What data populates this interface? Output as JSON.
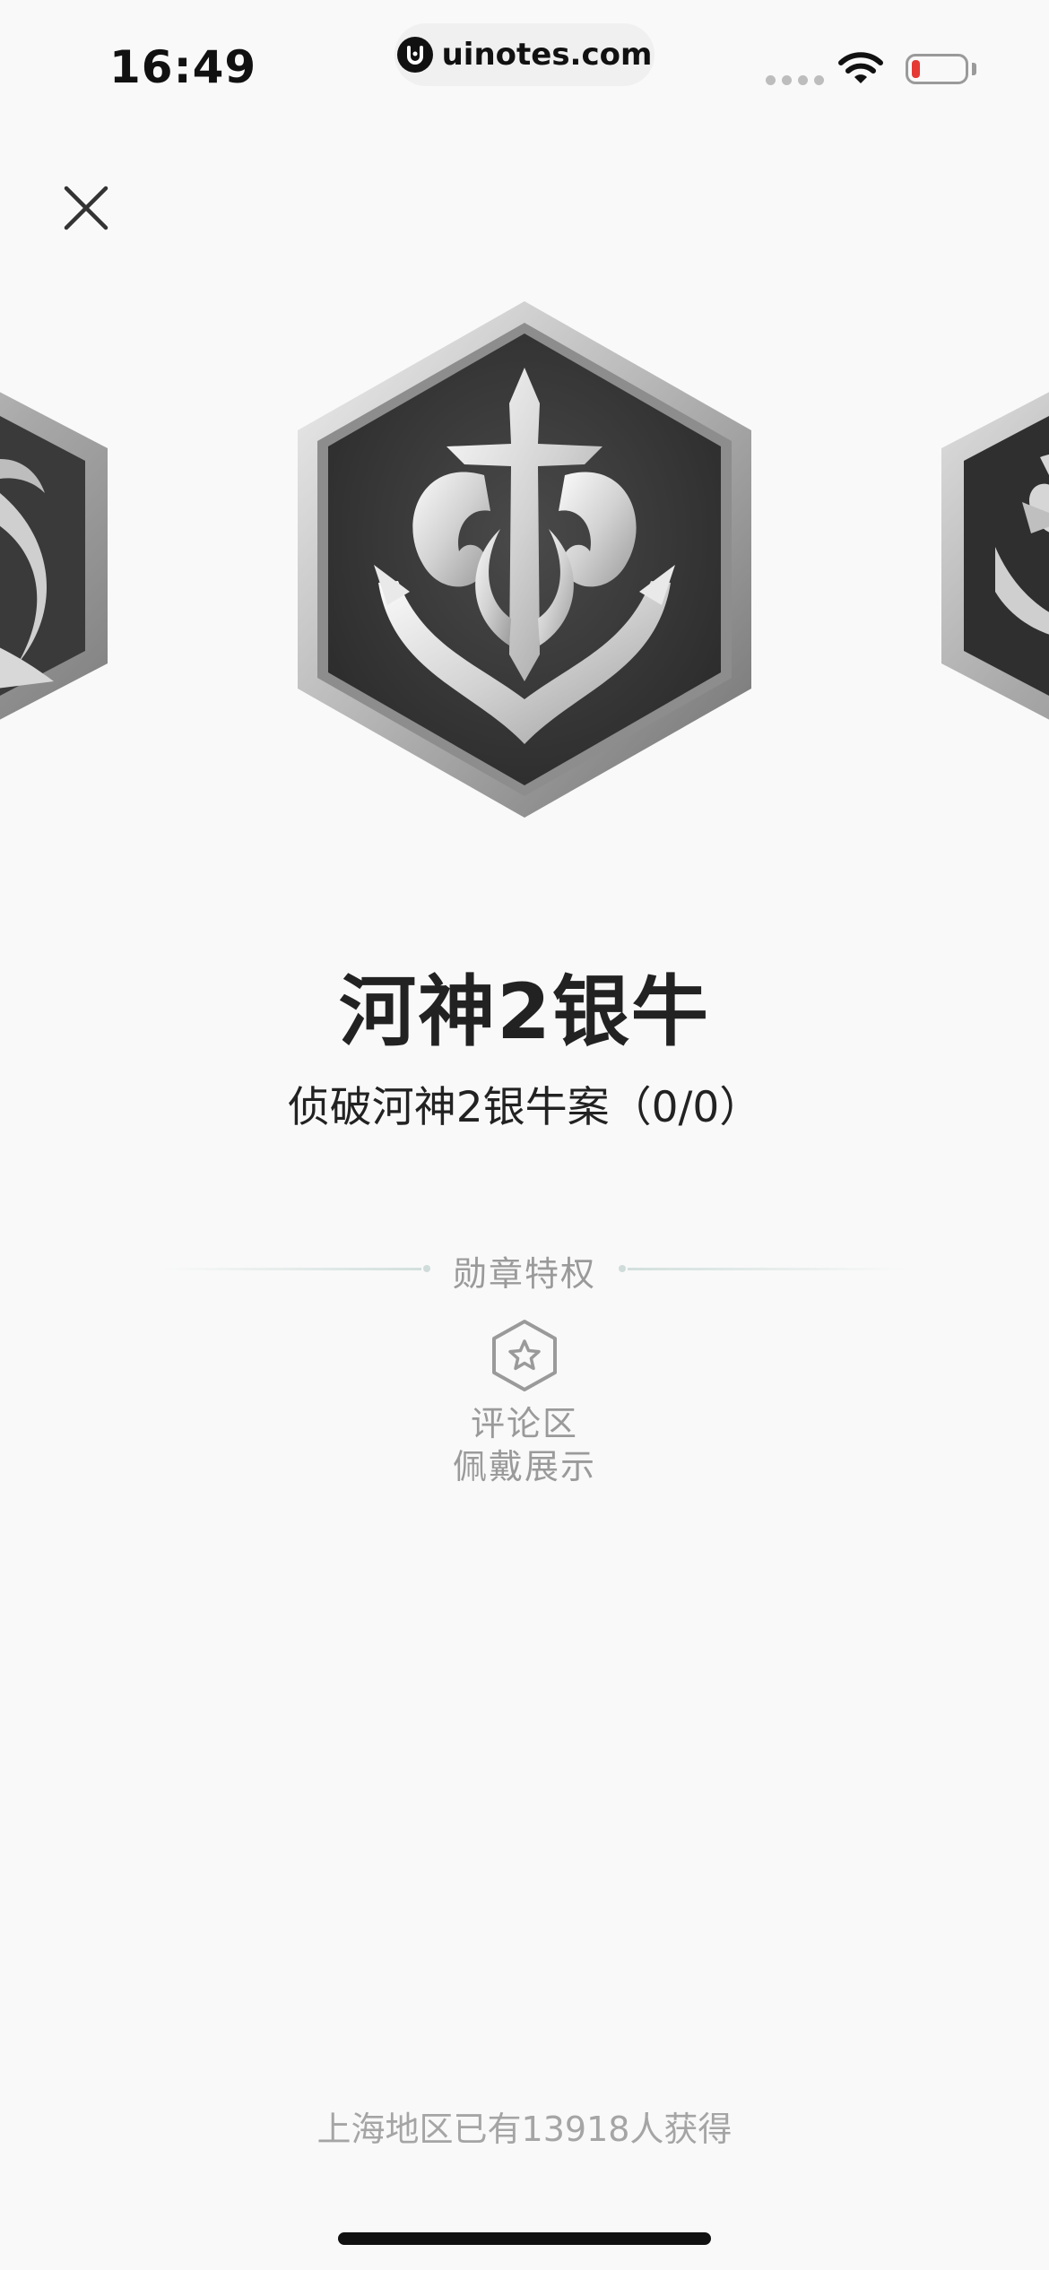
{
  "status_bar": {
    "time": "16:49",
    "url": "uinotes.com"
  },
  "icons": {
    "close": "close-icon",
    "wifi": "wifi-icon",
    "battery": "battery-icon",
    "anchor_badge": "anchor-badge-icon",
    "privilege": "star-hexagon-icon"
  },
  "badge": {
    "title": "河神2银牛",
    "description": "侦破河神2银牛案（0/0）"
  },
  "privileges": {
    "section_title": "勋章特权",
    "items": [
      {
        "label_line1": "评论区",
        "label_line2": "佩戴展示"
      }
    ]
  },
  "footer": {
    "stat": "上海地区已有13918人获得"
  },
  "colors": {
    "background": "#f9f9f9",
    "title_text": "#222222",
    "muted_text": "#9a9a9a",
    "battery_low": "#e53935"
  }
}
